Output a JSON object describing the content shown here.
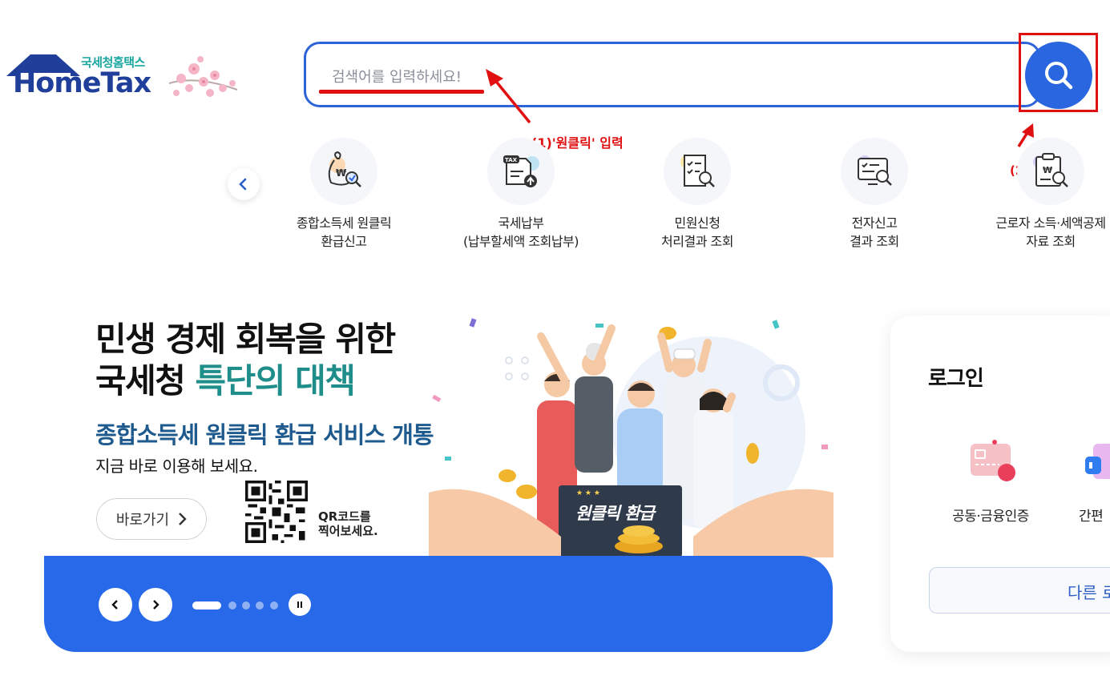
{
  "logo": {
    "sub": "국세청홈택스",
    "main": "HomeTax"
  },
  "search": {
    "placeholder": "검색어를 입력하세요!",
    "value": ""
  },
  "annotations": {
    "step1": "(1)'원클릭' 입력",
    "step2": "(2)"
  },
  "quick_menu": [
    {
      "line1": "종합소득세 원클릭",
      "line2": "환급신고",
      "icon": "money-bag-search-icon"
    },
    {
      "line1": "국세납부",
      "line2": "(납부할세액 조회납부)",
      "icon": "tax-document-upload-icon"
    },
    {
      "line1": "민원신청",
      "line2": "처리결과 조회",
      "icon": "checklist-search-icon"
    },
    {
      "line1": "전자신고",
      "line2": "결과 조회",
      "icon": "monitor-search-icon"
    },
    {
      "line1": "근로자 소득·세액공제",
      "line2": "자료 조회",
      "icon": "clipboard-won-search-icon"
    }
  ],
  "banner": {
    "title_line1": "민생 경제 회복을 위한",
    "title_line2_a": "국세청 ",
    "title_line2_b": "특단의 대책",
    "subtitle": "종합소득세 원클릭 환급 서비스 개통",
    "desc": "지금 바로 이용해 보세요.",
    "button": "바로가기",
    "qr_line1": "QR코드를",
    "qr_line2": "찍어보세요.",
    "sign": "원클릭 환급",
    "slides_total": 5,
    "slide_active": 1
  },
  "login": {
    "title": "로그인",
    "option1": "공동·금융인증",
    "option2": "간편",
    "other": "다른 로"
  },
  "colors": {
    "brand_blue": "#2a66e0",
    "annotation_red": "#e01010",
    "teal": "#1f8e8a"
  }
}
